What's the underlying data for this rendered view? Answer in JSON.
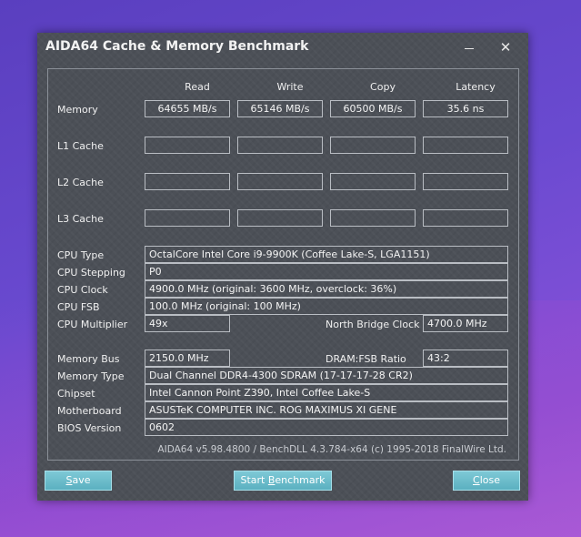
{
  "window": {
    "title": "AIDA64 Cache & Memory Benchmark",
    "minimize_icon": "minimize-icon",
    "close_icon": "close-x-icon"
  },
  "columns": [
    "Read",
    "Write",
    "Copy",
    "Latency"
  ],
  "rows": [
    {
      "label": "Memory",
      "values": [
        "64655 MB/s",
        "65146 MB/s",
        "60500 MB/s",
        "35.6 ns"
      ]
    },
    {
      "label": "L1 Cache",
      "values": [
        "",
        "",
        "",
        ""
      ]
    },
    {
      "label": "L2 Cache",
      "values": [
        "",
        "",
        "",
        ""
      ]
    },
    {
      "label": "L3 Cache",
      "values": [
        "",
        "",
        "",
        ""
      ]
    }
  ],
  "cpu": {
    "type_label": "CPU Type",
    "type_value": "OctalCore Intel Core i9-9900K  (Coffee Lake-S, LGA1151)",
    "stepping_label": "CPU Stepping",
    "stepping_value": "P0",
    "clock_label": "CPU Clock",
    "clock_value": "4900.0 MHz  (original: 3600 MHz, overclock: 36%)",
    "fsb_label": "CPU FSB",
    "fsb_value": "100.0 MHz  (original: 100 MHz)",
    "multiplier_label": "CPU Multiplier",
    "multiplier_value": "49x",
    "nb_clock_label": "North Bridge Clock",
    "nb_clock_value": "4700.0 MHz"
  },
  "memory": {
    "bus_label": "Memory Bus",
    "bus_value": "2150.0 MHz",
    "ratio_label": "DRAM:FSB Ratio",
    "ratio_value": "43:2",
    "type_label": "Memory Type",
    "type_value": "Dual Channel DDR4-4300 SDRAM  (17-17-17-28 CR2)",
    "chipset_label": "Chipset",
    "chipset_value": "Intel Cannon Point Z390, Intel Coffee Lake-S",
    "motherboard_label": "Motherboard",
    "motherboard_value": "ASUSTeK COMPUTER INC. ROG MAXIMUS XI GENE",
    "bios_label": "BIOS Version",
    "bios_value": "0602"
  },
  "footer": "AIDA64 v5.98.4800 / BenchDLL 4.3.784-x64  (c) 1995-2018 FinalWire Ltd.",
  "buttons": {
    "save_first": "S",
    "save_rest": "ave",
    "start": "Start ",
    "start_u": "B",
    "start_rest": "enchmark",
    "close_first": "C",
    "close_rest": "lose"
  }
}
